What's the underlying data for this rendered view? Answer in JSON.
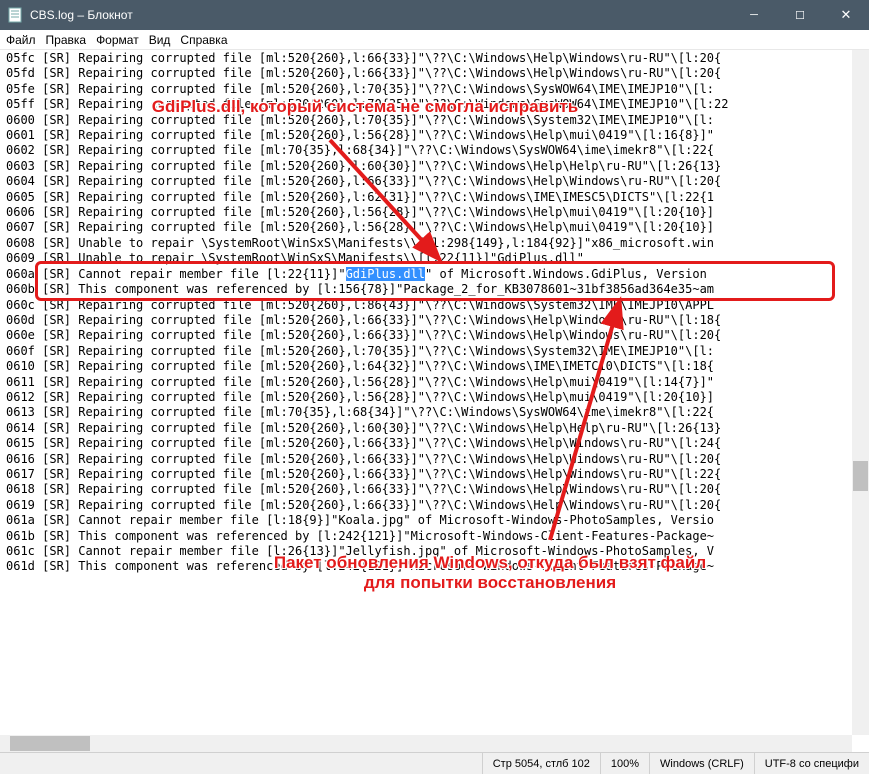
{
  "window": {
    "title": "CBS.log – Блокнот"
  },
  "menu": {
    "file": "Файл",
    "edit": "Правка",
    "format": "Формат",
    "view": "Вид",
    "help": "Справка"
  },
  "status": {
    "pos": "Стр 5054, стлб 102",
    "zoom": "100%",
    "eol": "Windows (CRLF)",
    "enc": "UTF-8 со специфи"
  },
  "anno1": "GdiPlus.dll, который система не\nсмогла исправить",
  "anno2": "Пакет обновления Windows, откуда\nбыл взят файл для попытки\nвосстановления",
  "highlight": "GdiPlus.dll",
  "lines": [
    "05fc [SR] Repairing corrupted file [ml:520{260},l:66{33}]\"\\??\\C:\\Windows\\Help\\Windows\\ru-RU\"\\[l:20{",
    "05fd [SR] Repairing corrupted file [ml:520{260},l:66{33}]\"\\??\\C:\\Windows\\Help\\Windows\\ru-RU\"\\[l:20{",
    "05fe [SR] Repairing corrupted file [ml:520{260},l:70{35}]\"\\??\\C:\\Windows\\SysWOW64\\IME\\IMEJP10\"\\[l:",
    "05ff [SR] Repairing corrupted file [ml:520{260},l:70{35}]\"\\??\\C:\\Windows\\SysWOW64\\IME\\IMEJP10\"\\[l:22",
    "0600 [SR] Repairing corrupted file [ml:520{260},l:70{35}]\"\\??\\C:\\Windows\\System32\\IME\\IMEJP10\"\\[l:",
    "0601 [SR] Repairing corrupted file [ml:520{260},l:56{28}]\"\\??\\C:\\Windows\\Help\\mui\\0419\"\\[l:16{8}]\"",
    "0602 [SR] Repairing corrupted file [ml:70{35},l:68{34}]\"\\??\\C:\\Windows\\SysWOW64\\ime\\imekr8\"\\[l:22{",
    "0603 [SR] Repairing corrupted file [ml:520{260},l:60{30}]\"\\??\\C:\\Windows\\Help\\Help\\ru-RU\"\\[l:26{13}",
    "0604 [SR] Repairing corrupted file [ml:520{260},l:66{33}]\"\\??\\C:\\Windows\\Help\\Windows\\ru-RU\"\\[l:20{",
    "0605 [SR] Repairing corrupted file [ml:520{260},l:62{31}]\"\\??\\C:\\Windows\\IME\\IMESC5\\DICTS\"\\[l:22{1",
    "0606 [SR] Repairing corrupted file [ml:520{260},l:56{28}]\"\\??\\C:\\Windows\\Help\\mui\\0419\"\\[l:20{10}]",
    "0607 [SR] Repairing corrupted file [ml:520{260},l:56{28}]\"\\??\\C:\\Windows\\Help\\mui\\0419\"\\[l:20{10}]",
    "0608 [SR] Unable to repair \\SystemRoot\\WinSxS\\Manifests\\\\[ml:298{149},l:184{92}]\"x86_microsoft.win",
    "0609 [SR] Unable to repair \\SystemRoot\\WinSxS\\Manifests\\\\[l:22{11}]\"GdiPlus.dll\"",
    "060a [SR] Cannot repair member file [l:22{11}]\"{HLSTART}{HL}\" of Microsoft.Windows.GdiPlus, Version ",
    "060b [SR] This component was referenced by [l:156{78}]\"Package_2_for_KB3078601~31bf3856ad364e35~am",
    "060c [SR] Repairing corrupted file [ml:520{260},l:86{43}]\"\\??\\C:\\Windows\\System32\\IME\\IMEJP10\\APPL",
    "060d [SR] Repairing corrupted file [ml:520{260},l:66{33}]\"\\??\\C:\\Windows\\Help\\Windows\\ru-RU\"\\[l:18{",
    "060e [SR] Repairing corrupted file [ml:520{260},l:66{33}]\"\\??\\C:\\Windows\\Help\\Windows\\ru-RU\"\\[l:20{",
    "060f [SR] Repairing corrupted file [ml:520{260},l:70{35}]\"\\??\\C:\\Windows\\System32\\IME\\IMEJP10\"\\[l:",
    "0610 [SR] Repairing corrupted file [ml:520{260},l:64{32}]\"\\??\\C:\\Windows\\IME\\IMETC10\\DICTS\"\\[l:18{",
    "0611 [SR] Repairing corrupted file [ml:520{260},l:56{28}]\"\\??\\C:\\Windows\\Help\\mui\\0419\"\\[l:14{7}]\"",
    "0612 [SR] Repairing corrupted file [ml:520{260},l:56{28}]\"\\??\\C:\\Windows\\Help\\mui\\0419\"\\[l:20{10}]",
    "0613 [SR] Repairing corrupted file [ml:70{35},l:68{34}]\"\\??\\C:\\Windows\\SysWOW64\\ime\\imekr8\"\\[l:22{",
    "0614 [SR] Repairing corrupted file [ml:520{260},l:60{30}]\"\\??\\C:\\Windows\\Help\\Help\\ru-RU\"\\[l:26{13}",
    "0615 [SR] Repairing corrupted file [ml:520{260},l:66{33}]\"\\??\\C:\\Windows\\Help\\Windows\\ru-RU\"\\[l:24{",
    "0616 [SR] Repairing corrupted file [ml:520{260},l:66{33}]\"\\??\\C:\\Windows\\Help\\Windows\\ru-RU\"\\[l:20{",
    "0617 [SR] Repairing corrupted file [ml:520{260},l:66{33}]\"\\??\\C:\\Windows\\Help\\Windows\\ru-RU\"\\[l:22{",
    "0618 [SR] Repairing corrupted file [ml:520{260},l:66{33}]\"\\??\\C:\\Windows\\Help\\Windows\\ru-RU\"\\[l:20{",
    "0619 [SR] Repairing corrupted file [ml:520{260},l:66{33}]\"\\??\\C:\\Windows\\Help\\Windows\\ru-RU\"\\[l:20{",
    "061a [SR] Cannot repair member file [l:18{9}]\"Koala.jpg\" of Microsoft-Windows-PhotoSamples, Versio",
    "061b [SR] This component was referenced by [l:242{121}]\"Microsoft-Windows-Client-Features-Package~",
    "061c [SR] Cannot repair member file [l:26{13}]\"Jellyfish.jpg\" of Microsoft-Windows-PhotoSamples, V",
    "061d [SR] This component was referenced by [l:242{121}]\"Microsoft-Windows-Client-Features-Package~"
  ]
}
